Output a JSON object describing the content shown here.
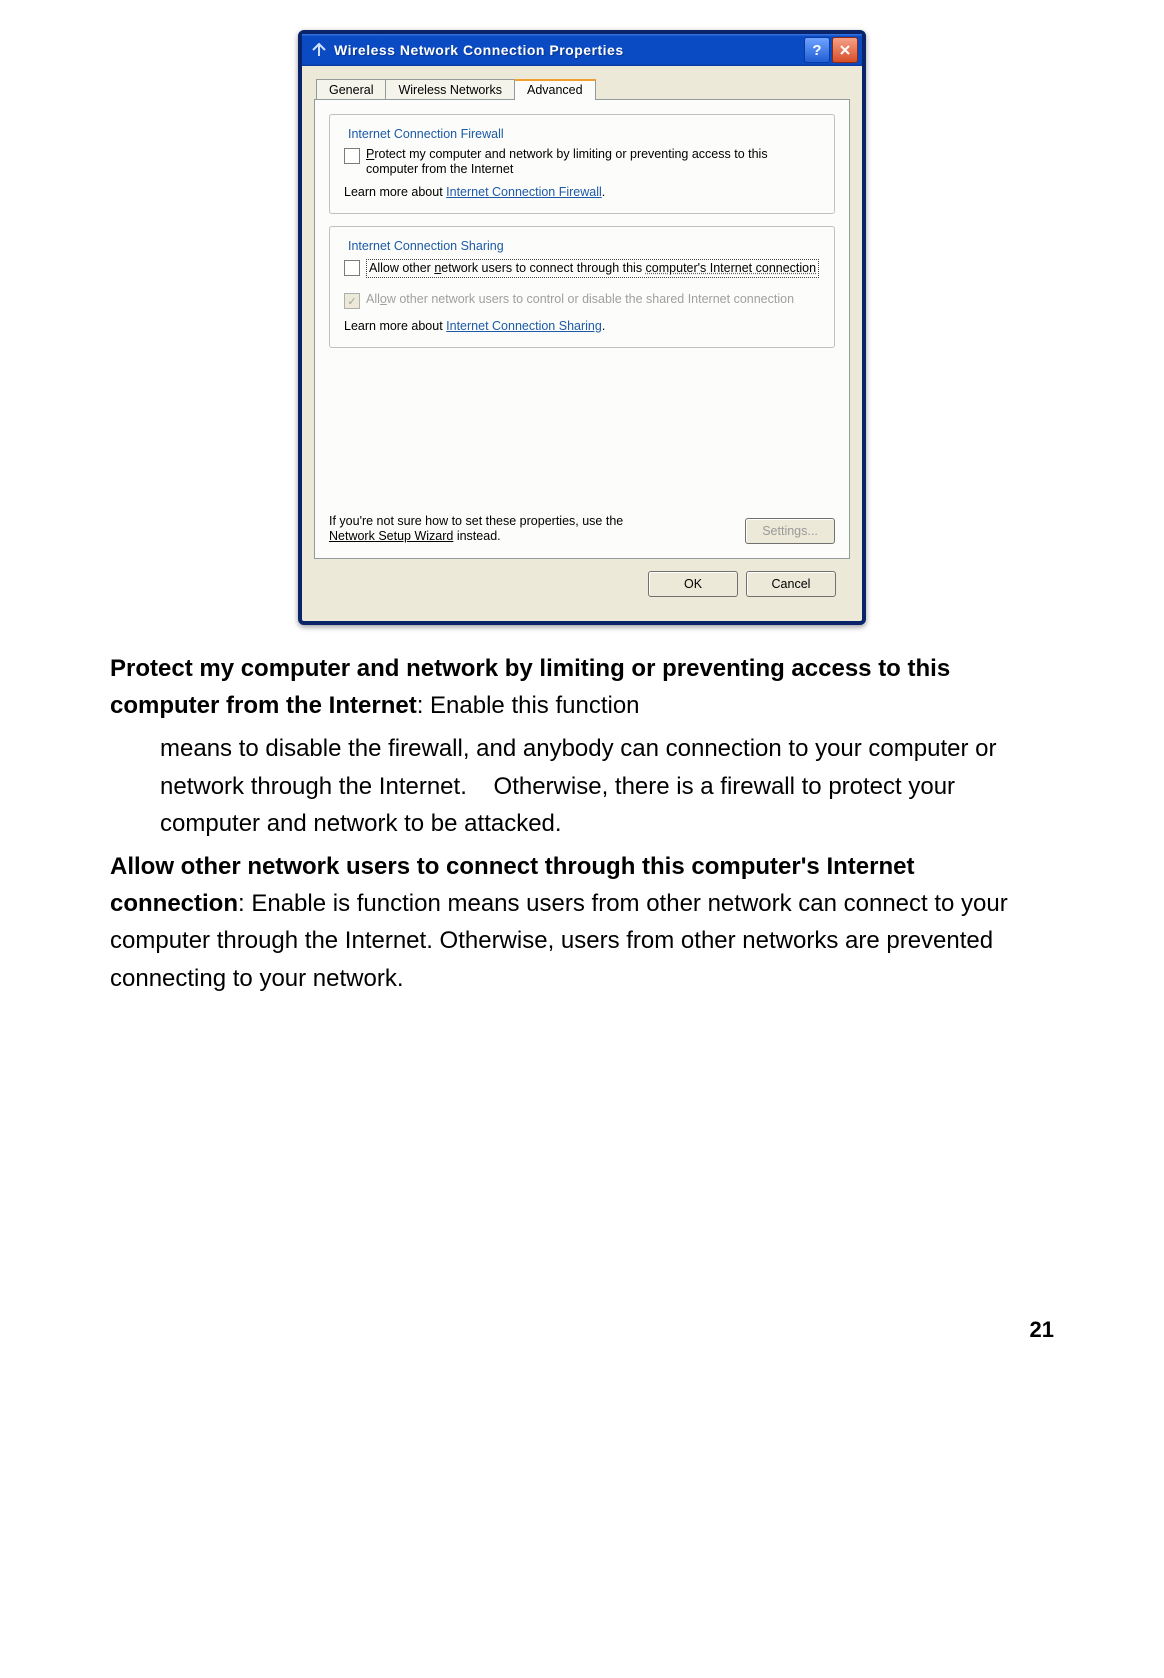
{
  "dialog": {
    "title": "Wireless Network Connection Properties",
    "tabs": {
      "general": "General",
      "wireless": "Wireless Networks",
      "advanced": "Advanced"
    },
    "firewall": {
      "legend": "Internet Connection Firewall",
      "protect_pre": "P",
      "protect_rest": "rotect my computer and network by limiting or preventing access to this computer from the Internet",
      "learn_prefix": "Learn more about ",
      "learn_link": "Internet Connection Firewall"
    },
    "sharing": {
      "legend": "Internet Connection Sharing",
      "allow1_pre": "Allow other ",
      "allow1_accel": "n",
      "allow1_mid": "etwork users to connect through this ",
      "allow1_end": "computer's Internet connection",
      "allow2_pre": "All",
      "allow2_accel": "o",
      "allow2_rest": "w other network users to control or disable the shared Internet connection",
      "learn_prefix": "Learn more about ",
      "learn_link": "Internet Connection Sharing"
    },
    "hint_prefix": "If you're not sure how to set these properties, use the ",
    "hint_link": "Network Setup Wizard",
    "hint_suffix": " instead.",
    "settings_btn": "Settings...",
    "ok": "OK",
    "cancel": "Cancel"
  },
  "text": {
    "p1a": "Protect my computer and network by limiting or preventing access to this computer from the Internet",
    "p1b": ": Enable this function",
    "p1c": "means to disable the firewall, and anybody can connection to your computer or network through the Internet.    Otherwise, there is a firewall to protect your computer and network to be attacked.",
    "p2a": "Allow other network users to connect through this computer's Internet connection",
    "p2b": ": Enable is function means users from other network can connect to your computer through the Internet. Otherwise, users from other networks are prevented connecting to your network.",
    "page_number": "21"
  }
}
